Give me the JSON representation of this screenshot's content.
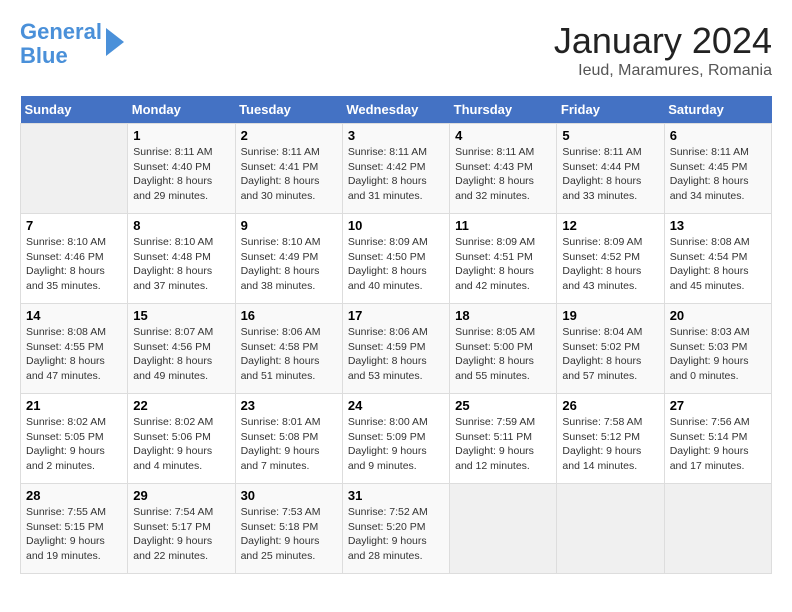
{
  "header": {
    "logo_line1": "General",
    "logo_line2": "Blue",
    "month": "January 2024",
    "location": "Ieud, Maramures, Romania"
  },
  "weekdays": [
    "Sunday",
    "Monday",
    "Tuesday",
    "Wednesday",
    "Thursday",
    "Friday",
    "Saturday"
  ],
  "weeks": [
    [
      {
        "day": "",
        "sunrise": "",
        "sunset": "",
        "daylight": ""
      },
      {
        "day": "1",
        "sunrise": "Sunrise: 8:11 AM",
        "sunset": "Sunset: 4:40 PM",
        "daylight": "Daylight: 8 hours and 29 minutes."
      },
      {
        "day": "2",
        "sunrise": "Sunrise: 8:11 AM",
        "sunset": "Sunset: 4:41 PM",
        "daylight": "Daylight: 8 hours and 30 minutes."
      },
      {
        "day": "3",
        "sunrise": "Sunrise: 8:11 AM",
        "sunset": "Sunset: 4:42 PM",
        "daylight": "Daylight: 8 hours and 31 minutes."
      },
      {
        "day": "4",
        "sunrise": "Sunrise: 8:11 AM",
        "sunset": "Sunset: 4:43 PM",
        "daylight": "Daylight: 8 hours and 32 minutes."
      },
      {
        "day": "5",
        "sunrise": "Sunrise: 8:11 AM",
        "sunset": "Sunset: 4:44 PM",
        "daylight": "Daylight: 8 hours and 33 minutes."
      },
      {
        "day": "6",
        "sunrise": "Sunrise: 8:11 AM",
        "sunset": "Sunset: 4:45 PM",
        "daylight": "Daylight: 8 hours and 34 minutes."
      }
    ],
    [
      {
        "day": "7",
        "sunrise": "Sunrise: 8:10 AM",
        "sunset": "Sunset: 4:46 PM",
        "daylight": "Daylight: 8 hours and 35 minutes."
      },
      {
        "day": "8",
        "sunrise": "Sunrise: 8:10 AM",
        "sunset": "Sunset: 4:48 PM",
        "daylight": "Daylight: 8 hours and 37 minutes."
      },
      {
        "day": "9",
        "sunrise": "Sunrise: 8:10 AM",
        "sunset": "Sunset: 4:49 PM",
        "daylight": "Daylight: 8 hours and 38 minutes."
      },
      {
        "day": "10",
        "sunrise": "Sunrise: 8:09 AM",
        "sunset": "Sunset: 4:50 PM",
        "daylight": "Daylight: 8 hours and 40 minutes."
      },
      {
        "day": "11",
        "sunrise": "Sunrise: 8:09 AM",
        "sunset": "Sunset: 4:51 PM",
        "daylight": "Daylight: 8 hours and 42 minutes."
      },
      {
        "day": "12",
        "sunrise": "Sunrise: 8:09 AM",
        "sunset": "Sunset: 4:52 PM",
        "daylight": "Daylight: 8 hours and 43 minutes."
      },
      {
        "day": "13",
        "sunrise": "Sunrise: 8:08 AM",
        "sunset": "Sunset: 4:54 PM",
        "daylight": "Daylight: 8 hours and 45 minutes."
      }
    ],
    [
      {
        "day": "14",
        "sunrise": "Sunrise: 8:08 AM",
        "sunset": "Sunset: 4:55 PM",
        "daylight": "Daylight: 8 hours and 47 minutes."
      },
      {
        "day": "15",
        "sunrise": "Sunrise: 8:07 AM",
        "sunset": "Sunset: 4:56 PM",
        "daylight": "Daylight: 8 hours and 49 minutes."
      },
      {
        "day": "16",
        "sunrise": "Sunrise: 8:06 AM",
        "sunset": "Sunset: 4:58 PM",
        "daylight": "Daylight: 8 hours and 51 minutes."
      },
      {
        "day": "17",
        "sunrise": "Sunrise: 8:06 AM",
        "sunset": "Sunset: 4:59 PM",
        "daylight": "Daylight: 8 hours and 53 minutes."
      },
      {
        "day": "18",
        "sunrise": "Sunrise: 8:05 AM",
        "sunset": "Sunset: 5:00 PM",
        "daylight": "Daylight: 8 hours and 55 minutes."
      },
      {
        "day": "19",
        "sunrise": "Sunrise: 8:04 AM",
        "sunset": "Sunset: 5:02 PM",
        "daylight": "Daylight: 8 hours and 57 minutes."
      },
      {
        "day": "20",
        "sunrise": "Sunrise: 8:03 AM",
        "sunset": "Sunset: 5:03 PM",
        "daylight": "Daylight: 9 hours and 0 minutes."
      }
    ],
    [
      {
        "day": "21",
        "sunrise": "Sunrise: 8:02 AM",
        "sunset": "Sunset: 5:05 PM",
        "daylight": "Daylight: 9 hours and 2 minutes."
      },
      {
        "day": "22",
        "sunrise": "Sunrise: 8:02 AM",
        "sunset": "Sunset: 5:06 PM",
        "daylight": "Daylight: 9 hours and 4 minutes."
      },
      {
        "day": "23",
        "sunrise": "Sunrise: 8:01 AM",
        "sunset": "Sunset: 5:08 PM",
        "daylight": "Daylight: 9 hours and 7 minutes."
      },
      {
        "day": "24",
        "sunrise": "Sunrise: 8:00 AM",
        "sunset": "Sunset: 5:09 PM",
        "daylight": "Daylight: 9 hours and 9 minutes."
      },
      {
        "day": "25",
        "sunrise": "Sunrise: 7:59 AM",
        "sunset": "Sunset: 5:11 PM",
        "daylight": "Daylight: 9 hours and 12 minutes."
      },
      {
        "day": "26",
        "sunrise": "Sunrise: 7:58 AM",
        "sunset": "Sunset: 5:12 PM",
        "daylight": "Daylight: 9 hours and 14 minutes."
      },
      {
        "day": "27",
        "sunrise": "Sunrise: 7:56 AM",
        "sunset": "Sunset: 5:14 PM",
        "daylight": "Daylight: 9 hours and 17 minutes."
      }
    ],
    [
      {
        "day": "28",
        "sunrise": "Sunrise: 7:55 AM",
        "sunset": "Sunset: 5:15 PM",
        "daylight": "Daylight: 9 hours and 19 minutes."
      },
      {
        "day": "29",
        "sunrise": "Sunrise: 7:54 AM",
        "sunset": "Sunset: 5:17 PM",
        "daylight": "Daylight: 9 hours and 22 minutes."
      },
      {
        "day": "30",
        "sunrise": "Sunrise: 7:53 AM",
        "sunset": "Sunset: 5:18 PM",
        "daylight": "Daylight: 9 hours and 25 minutes."
      },
      {
        "day": "31",
        "sunrise": "Sunrise: 7:52 AM",
        "sunset": "Sunset: 5:20 PM",
        "daylight": "Daylight: 9 hours and 28 minutes."
      },
      {
        "day": "",
        "sunrise": "",
        "sunset": "",
        "daylight": ""
      },
      {
        "day": "",
        "sunrise": "",
        "sunset": "",
        "daylight": ""
      },
      {
        "day": "",
        "sunrise": "",
        "sunset": "",
        "daylight": ""
      }
    ]
  ]
}
